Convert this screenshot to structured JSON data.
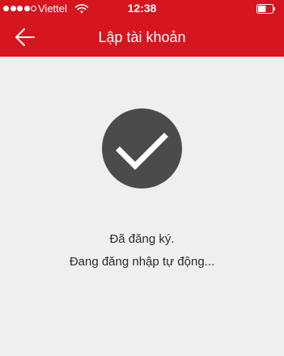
{
  "status_bar": {
    "carrier": "Viettel",
    "time": "12:38",
    "signal_bars_filled": 4,
    "signal_bars_total": 5,
    "battery_level": 0.55
  },
  "nav_bar": {
    "title": "Lập tài khoản",
    "back_icon": "arrow-left-icon"
  },
  "main": {
    "status_icon": "checkmark-icon",
    "line1": "Đã đăng ký.",
    "line2": "Đang đăng nhập tự động..."
  },
  "colors": {
    "brand_red": "#d5161f",
    "background": "#efeff0",
    "circle": "#4b4b4b",
    "text": "#2b2b2b"
  }
}
